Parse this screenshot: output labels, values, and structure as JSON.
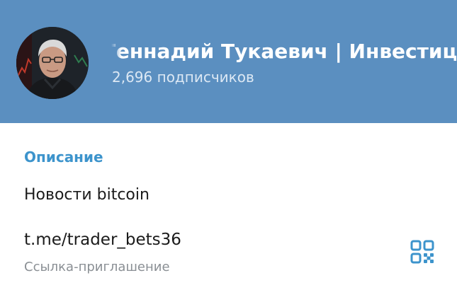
{
  "channel": {
    "title": "Геннадий Тукаевич | Инвестиции",
    "subscribers": "2,696 подписчиков",
    "avatar_icon": "profile-photo"
  },
  "info": {
    "description_label": "Описание",
    "description": "Новости bitcoin",
    "link": "t.me/trader_bets36",
    "link_caption": "Ссылка-приглашение",
    "qr_icon": "qr-code-icon"
  },
  "colors": {
    "header_bg": "#5b8fc0",
    "accent": "#3d94cc",
    "text": "#1b1b1b",
    "secondary_text": "#8a8f94"
  }
}
